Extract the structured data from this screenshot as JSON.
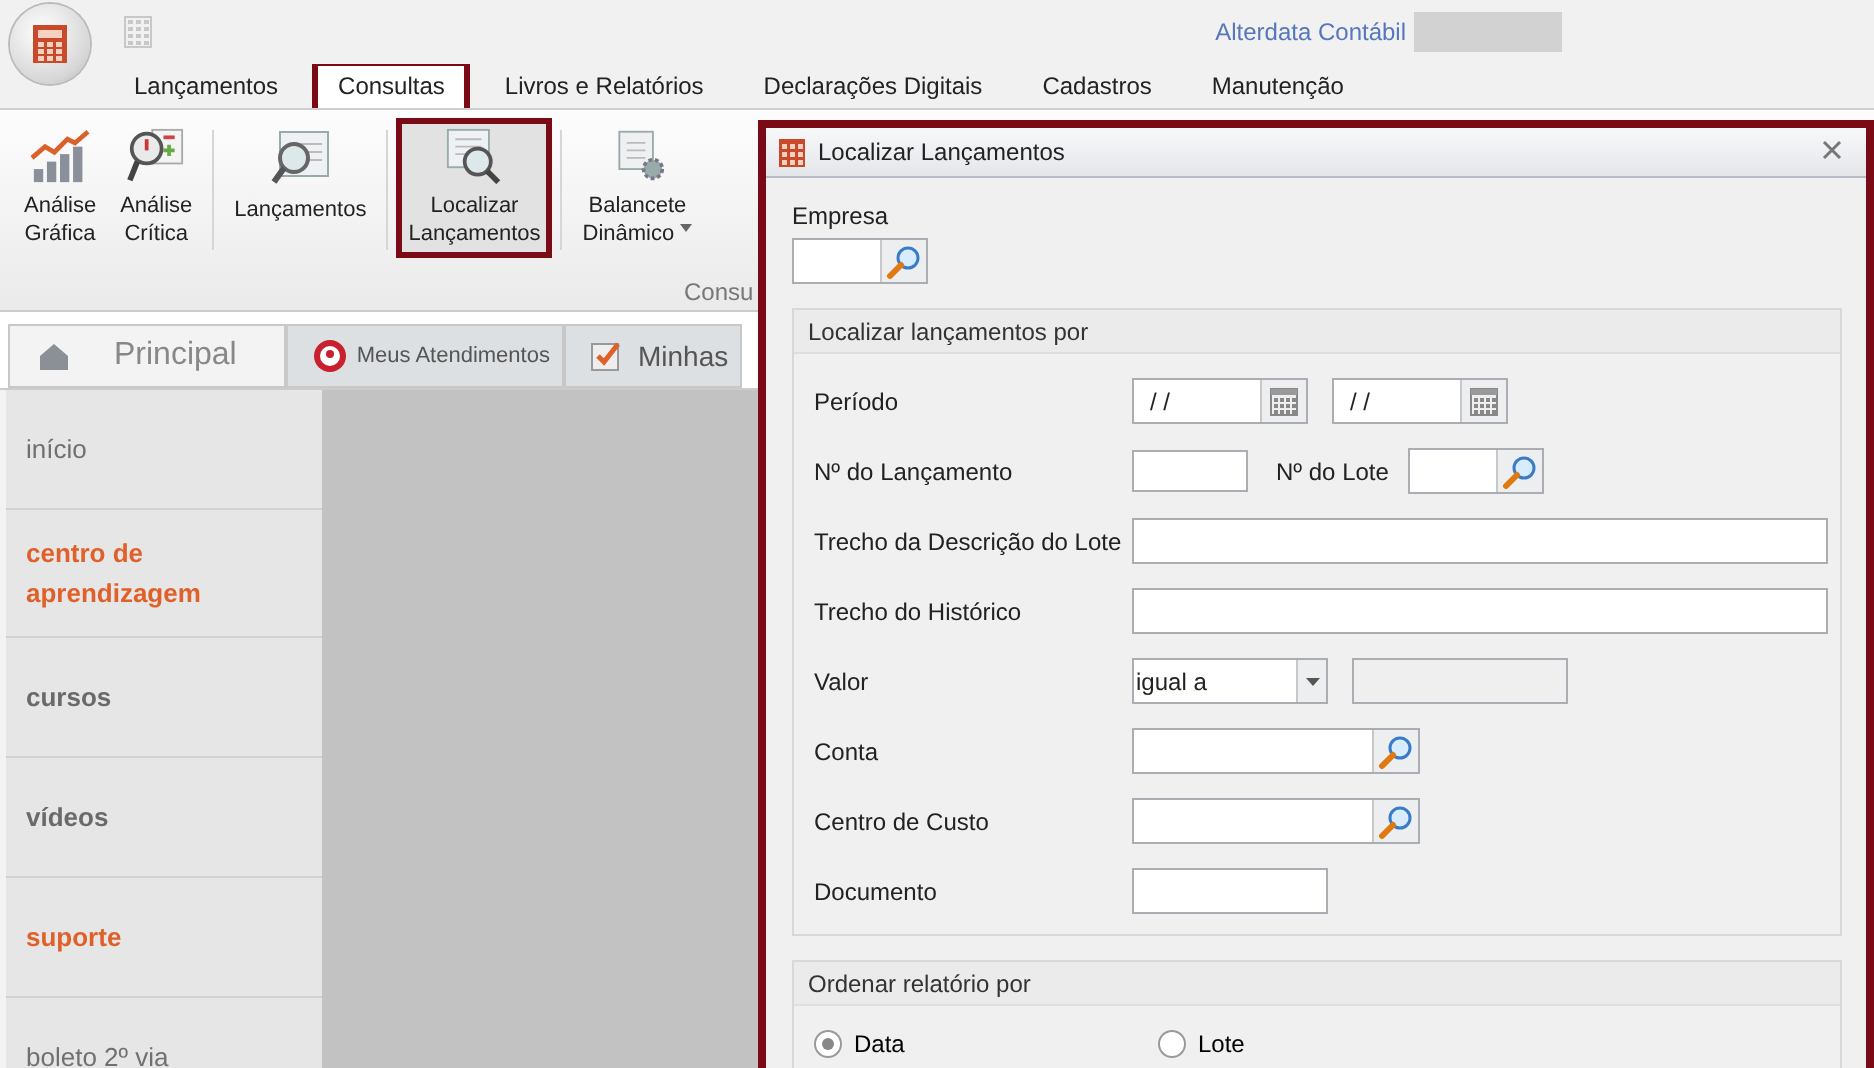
{
  "window": {
    "title": "Alterdata Contábil"
  },
  "menu_tabs": [
    {
      "label": "Lançamentos",
      "selected": false
    },
    {
      "label": "Consultas",
      "selected": true
    },
    {
      "label": "Livros e Relatórios",
      "selected": false
    },
    {
      "label": "Declarações Digitais",
      "selected": false
    },
    {
      "label": "Cadastros",
      "selected": false
    },
    {
      "label": "Manutenção",
      "selected": false
    }
  ],
  "ribbon": {
    "buttons": [
      {
        "line1": "Análise",
        "line2": "Gráfica",
        "kind": "chart",
        "selected": false
      },
      {
        "line1": "Análise",
        "line2": "Crítica",
        "kind": "critic",
        "selected": false
      },
      {
        "line1": "Lançamentos",
        "kind": "search",
        "selected": false
      },
      {
        "line1": "Localizar",
        "line2": "Lançamentos",
        "kind": "find",
        "selected": true
      },
      {
        "line1": "Balancete",
        "line2": "Dinâmico",
        "kind": "balance",
        "selected": false
      }
    ],
    "group_label": "Consu"
  },
  "page_tabs": [
    {
      "label": "Principal",
      "kind": "home",
      "selected": true
    },
    {
      "label": "Meus Atendimentos",
      "kind": "support",
      "selected": false
    },
    {
      "label": "Minhas",
      "kind": "check",
      "selected": false
    }
  ],
  "sidebar": {
    "items": [
      {
        "label": "início",
        "color": "#707070",
        "bold": false
      },
      {
        "label": "centro de aprendizagem",
        "color": "#e0602a",
        "bold": true
      },
      {
        "label": "cursos",
        "color": "#6a6a6a",
        "bold": true
      },
      {
        "label": "vídeos",
        "color": "#6a6a6a",
        "bold": true
      },
      {
        "label": "suporte",
        "color": "#e0602a",
        "bold": true
      },
      {
        "label": "boleto 2º via",
        "color": "#707070",
        "bold": false
      }
    ]
  },
  "dialog": {
    "title": "Localizar Lançamentos",
    "empresa_label": "Empresa",
    "search_group": {
      "title": "Localizar lançamentos por",
      "rows": [
        {
          "label": "Período",
          "kind": "dates",
          "values": [
            "/ /",
            "/ /"
          ]
        },
        {
          "label": "Nº do Lançamento",
          "kind": "number_lot",
          "second_label": "Nº do Lote"
        },
        {
          "label": "Trecho da Descrição do Lote",
          "kind": "wide"
        },
        {
          "label": "Trecho do Histórico",
          "kind": "wide"
        },
        {
          "label": "Valor",
          "kind": "select",
          "value": "igual a"
        },
        {
          "label": "Conta",
          "kind": "lookup"
        },
        {
          "label": "Centro de Custo",
          "kind": "lookup"
        },
        {
          "label": "Documento",
          "kind": "text"
        }
      ]
    },
    "order_group": {
      "title": "Ordenar relatório por",
      "options": [
        {
          "label": "Data",
          "selected": true
        },
        {
          "label": "Lote",
          "selected": false
        }
      ]
    }
  }
}
